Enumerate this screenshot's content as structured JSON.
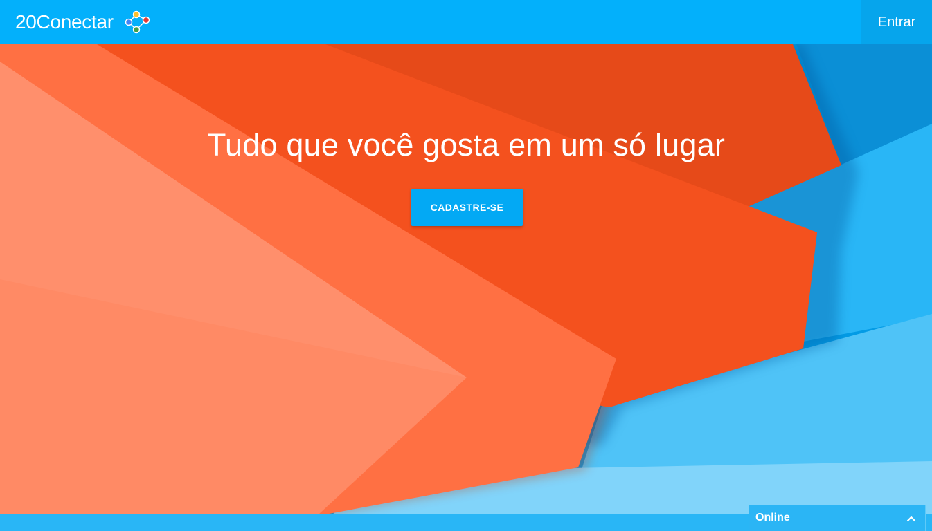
{
  "header": {
    "logo_text": "20Conectar",
    "login_label": "Entrar"
  },
  "hero": {
    "headline": "Tudo que você gosta em um só lugar",
    "cta_label": "CADASTRE-SE"
  },
  "chat_widget": {
    "status_label": "Online",
    "toggle_icon": "chevron-up-icon"
  },
  "colors": {
    "primary": "#03b0fb",
    "accent_orange": "#f4511e",
    "accent_coral": "#ff7043",
    "light_blue": "#4fc3f7"
  }
}
